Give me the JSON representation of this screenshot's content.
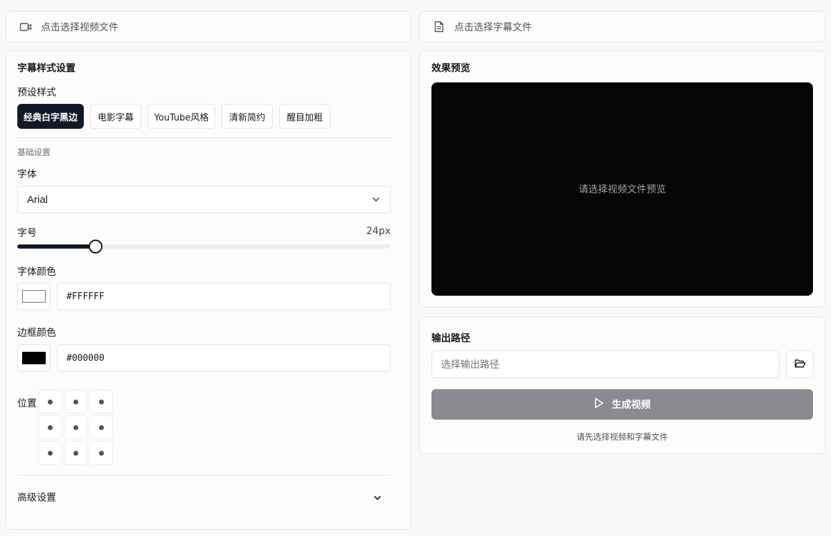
{
  "video_picker": {
    "label": "点击选择视频文件",
    "icon": "video-icon"
  },
  "subtitle_picker": {
    "label": "点击选择字幕文件",
    "icon": "file-text-icon"
  },
  "style_panel": {
    "title": "字幕样式设置",
    "presets_label": "预设样式",
    "presets": [
      "经典白字黑边",
      "电影字幕",
      "YouTube风格",
      "清新简约",
      "醒目加粗"
    ],
    "active_preset": 0,
    "basic_section": "基础设置",
    "font_label": "字体",
    "font_value": "Arial",
    "size_label": "字号",
    "size_value": "24px",
    "size_fraction": 0.21,
    "font_color_label": "字体颜色",
    "font_color_value": "#FFFFFF",
    "border_color_label": "边框颜色",
    "border_color_value": "#000000",
    "position_label": "位置",
    "position_selected": 7,
    "advanced_label": "高级设置"
  },
  "preview_panel": {
    "title": "效果预览",
    "placeholder": "请选择视频文件预览"
  },
  "output_panel": {
    "title": "输出路径",
    "path_placeholder": "选择输出路径",
    "generate_label": "生成视频",
    "hint": "请先选择视频和字幕文件"
  },
  "colors": {
    "accent_dark": "#111827",
    "disabled_button": "#8a8b90",
    "preview_bg": "#050505"
  }
}
